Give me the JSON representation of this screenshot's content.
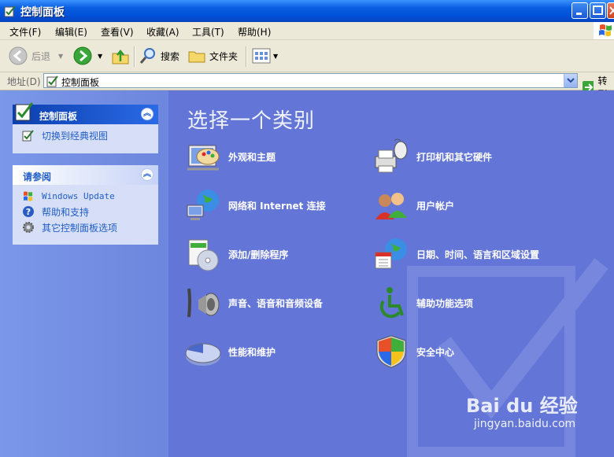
{
  "window": {
    "title": "控制面板"
  },
  "menu": [
    "文件(F)",
    "编辑(E)",
    "查看(V)",
    "收藏(A)",
    "工具(T)",
    "帮助(H)"
  ],
  "toolbar": {
    "back": "后退",
    "search": "搜索",
    "folders": "文件夹"
  },
  "address": {
    "label": "地址(D)",
    "value": "控制面板",
    "go": "转到"
  },
  "left": {
    "control_panel": {
      "title": "控制面板",
      "switch_view": "切换到经典视图"
    },
    "see_also": {
      "title": "请参阅",
      "items": [
        "Windows Update",
        "帮助和支持",
        "其它控制面板选项"
      ]
    }
  },
  "main": {
    "title": "选择一个类别",
    "categories": [
      "外观和主题",
      "打印机和其它硬件",
      "网络和 Internet 连接",
      "用户帐户",
      "添加/删除程序",
      "日期、时间、语言和区域设置",
      "声音、语音和音频设备",
      "辅助功能选项",
      "性能和维护",
      "安全中心"
    ]
  },
  "watermark": {
    "logo": "Bai du 经验",
    "url": "jingyan.baidu.com"
  }
}
